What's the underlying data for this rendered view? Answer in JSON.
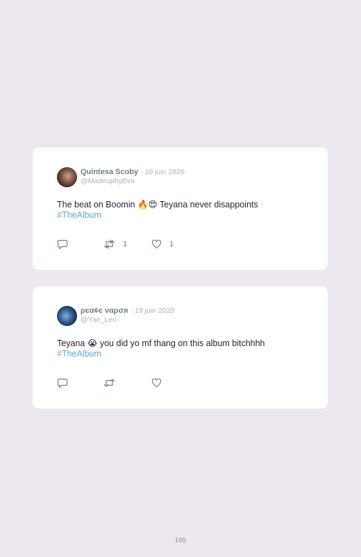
{
  "tweets": [
    {
      "name": "Quintesa Scoby",
      "date": "· 19 juin 2020",
      "handle": "@MadeupbyEva",
      "text": "The beat on Boomin 🔥😍 Teyana never disappoints",
      "hashtag": "#TheAlbum",
      "reply_count": "",
      "retweet_count": "1",
      "like_count": "1"
    },
    {
      "name": "ρєα¢є ναρσя",
      "date": "· 19 juin 2020",
      "handle": "@Yae_Leo",
      "text": "Teyana 😭 you did yo mf thang on this album bitchhhh",
      "hashtag": "#TheAlbum",
      "reply_count": "",
      "retweet_count": "",
      "like_count": ""
    }
  ],
  "page_number": "165",
  "colors": {
    "background": "#ede8ef",
    "card": "#ffffff",
    "hashtag": "#5aa6d9",
    "name": "#6f7e8c",
    "muted": "#a9b2bb"
  },
  "icons": [
    "reply-icon",
    "retweet-icon",
    "like-icon"
  ]
}
